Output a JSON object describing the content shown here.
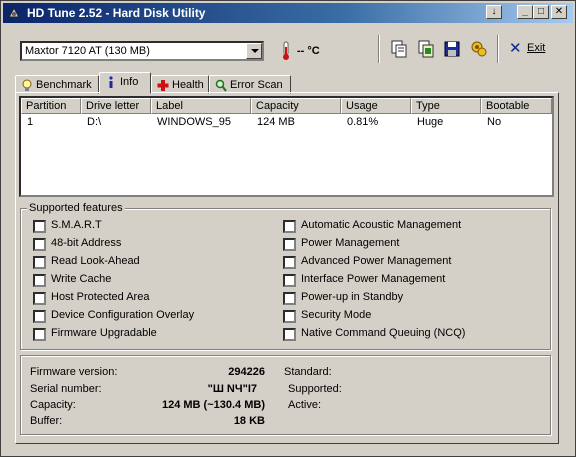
{
  "window": {
    "title": "HD Tune 2.52 - Hard Disk Utility",
    "buttons": [
      "↓",
      "_",
      "□",
      "✕"
    ]
  },
  "toolbar": {
    "drive_selected": "Maxtor 7120 AT (130 MB)",
    "temperature": "-- °C",
    "exit_label": "Exit"
  },
  "tabs": [
    {
      "label": "Benchmark",
      "icon": "lightbulb-icon",
      "active": false
    },
    {
      "label": "Info",
      "icon": "info-icon",
      "active": true
    },
    {
      "label": "Health",
      "icon": "health-cross-icon",
      "active": false
    },
    {
      "label": "Error Scan",
      "icon": "magnifier-icon",
      "active": false
    }
  ],
  "partitions": {
    "columns": [
      "Partition",
      "Drive letter",
      "Label",
      "Capacity",
      "Usage",
      "Type",
      "Bootable"
    ],
    "rows": [
      [
        "1",
        "D:\\",
        "WINDOWS_95",
        "124 MB",
        "0.81%",
        "Huge",
        "No"
      ]
    ]
  },
  "features": {
    "title": "Supported features",
    "left": [
      "S.M.A.R.T",
      "48-bit Address",
      "Read Look-Ahead",
      "Write Cache",
      "Host Protected Area",
      "Device Configuration Overlay",
      "Firmware Upgradable"
    ],
    "right": [
      "Automatic Acoustic Management",
      "Power Management",
      "Advanced Power Management",
      "Interface Power Management",
      "Power-up in Standby",
      "Security Mode",
      "Native Command Queuing (NCQ)"
    ]
  },
  "details": {
    "firmware_label": "Firmware version:",
    "firmware_value": "294226",
    "serial_label": "Serial number:",
    "serial_value": "\"Ш      NЧ\"I7",
    "capacity_label": "Capacity:",
    "capacity_value": "124 MB (~130.4 MB)",
    "buffer_label": "Buffer:",
    "buffer_value": "18 KB",
    "standard_label": "Standard:",
    "supported_label": "Supported:",
    "active_label": "Active:"
  },
  "colors": {
    "title_bar": "#0a246a",
    "face": "#d4d0c8"
  }
}
